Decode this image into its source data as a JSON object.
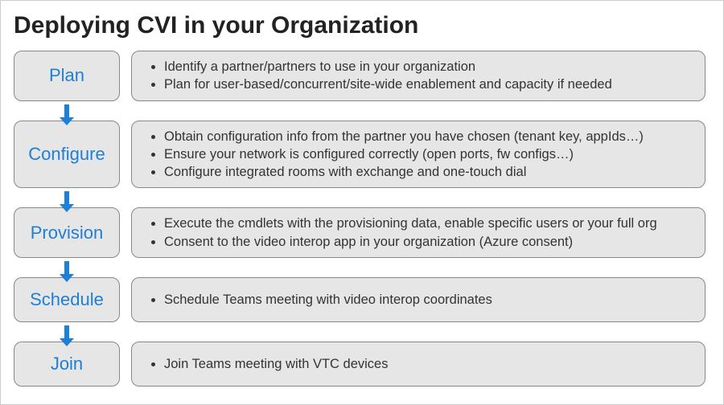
{
  "title": "Deploying CVI in your Organization",
  "steps": [
    {
      "label": "Plan",
      "details": [
        "Identify a partner/partners to use in your organization",
        "Plan for user-based/concurrent/site-wide enablement and capacity if needed"
      ]
    },
    {
      "label": "Configure",
      "details": [
        "Obtain configuration info from the partner you have chosen (tenant key, appIds…)",
        "Ensure your network is configured correctly (open ports, fw configs…)",
        "Configure integrated rooms with exchange and one-touch dial"
      ]
    },
    {
      "label": "Provision",
      "details": [
        "Execute the cmdlets with the provisioning data, enable specific users or your full org",
        "Consent to the video interop app in your organization (Azure consent)"
      ]
    },
    {
      "label": "Schedule",
      "details": [
        "Schedule Teams meeting with video interop coordinates"
      ]
    },
    {
      "label": "Join",
      "details": [
        "Join Teams meeting with VTC devices"
      ]
    }
  ]
}
